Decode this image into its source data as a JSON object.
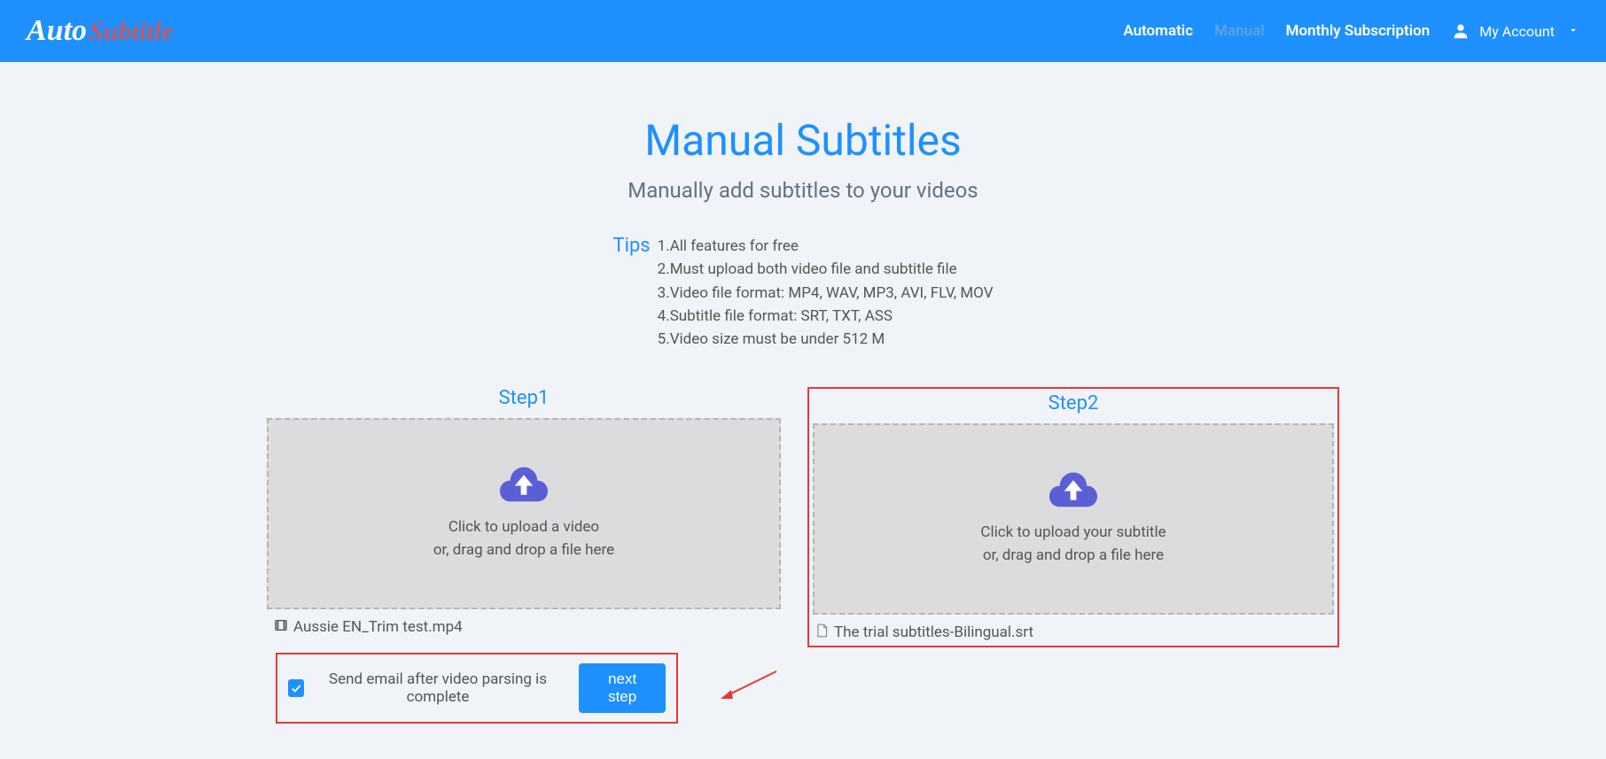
{
  "logo": {
    "part1": "Auto",
    "part2": "Subtitle"
  },
  "nav": {
    "automatic": "Automatic",
    "manual": "Manual",
    "subscription": "Monthly Subscription",
    "account": "My Account"
  },
  "page": {
    "title": "Manual Subtitles",
    "subtitle": "Manually add subtitles to your videos"
  },
  "tips": {
    "label": "Tips",
    "items": {
      "t1": "1.All features for free",
      "t2": "2.Must upload both video file and subtitle file",
      "t3": "3.Video file format: MP4, WAV, MP3, AVI, FLV, MOV",
      "t4": "4.Subtitle file format: SRT, TXT, ASS",
      "t5": "5.Video size must be under 512 M"
    }
  },
  "step1": {
    "label": "Step1",
    "line1": "Click to upload a video",
    "line2": "or, drag and drop a file here",
    "filename": "Aussie EN_Trim test.mp4"
  },
  "step2": {
    "label": "Step2",
    "line1": "Click to upload your subtitle",
    "line2": "or, drag and drop a file here",
    "filename": "The trial subtitles-Bilingual.srt"
  },
  "bottom": {
    "checkbox_label": "Send email after video parsing is complete",
    "next_btn": "next step"
  }
}
